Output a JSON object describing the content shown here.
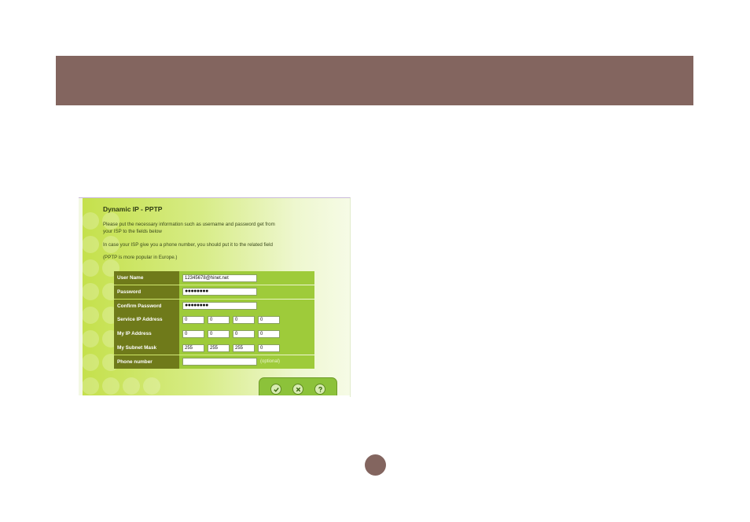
{
  "form": {
    "title": "Dynamic IP - PPTP",
    "intro_line1": "Please put the necessary information such as username and password get from",
    "intro_line2": "your ISP to the fields below",
    "phone_note": "In case your ISP give you a phone number, you should put it to the related field",
    "europe_note": "(PPTP is more popular in Europe.)",
    "rows": {
      "user_name": {
        "label": "User Name",
        "value": "12345678@hinet.net"
      },
      "password": {
        "label": "Password",
        "value": "●●●●●●●●"
      },
      "confirm_password": {
        "label": "Confirm Password",
        "value": "●●●●●●●●"
      },
      "service_ip": {
        "label": "Service IP Address",
        "octets": [
          "0",
          "0",
          "0",
          "0"
        ]
      },
      "my_ip": {
        "label": "My IP Address",
        "octets": [
          "0",
          "0",
          "0",
          "0"
        ]
      },
      "subnet_mask": {
        "label": "My Subnet Mask",
        "octets": [
          "255",
          "255",
          "255",
          "0"
        ]
      },
      "phone_number": {
        "label": "Phone number",
        "value": "",
        "hint": "(optional)"
      }
    }
  },
  "buttons": {
    "apply_icon": "check-icon",
    "cancel_icon": "cross-icon",
    "help_icon": "question-icon"
  },
  "colors": {
    "header_band": "#83655f",
    "label_cell": "#6f7a1a",
    "value_cell": "#9ecb3a",
    "panel_green": "#c4e04a"
  }
}
